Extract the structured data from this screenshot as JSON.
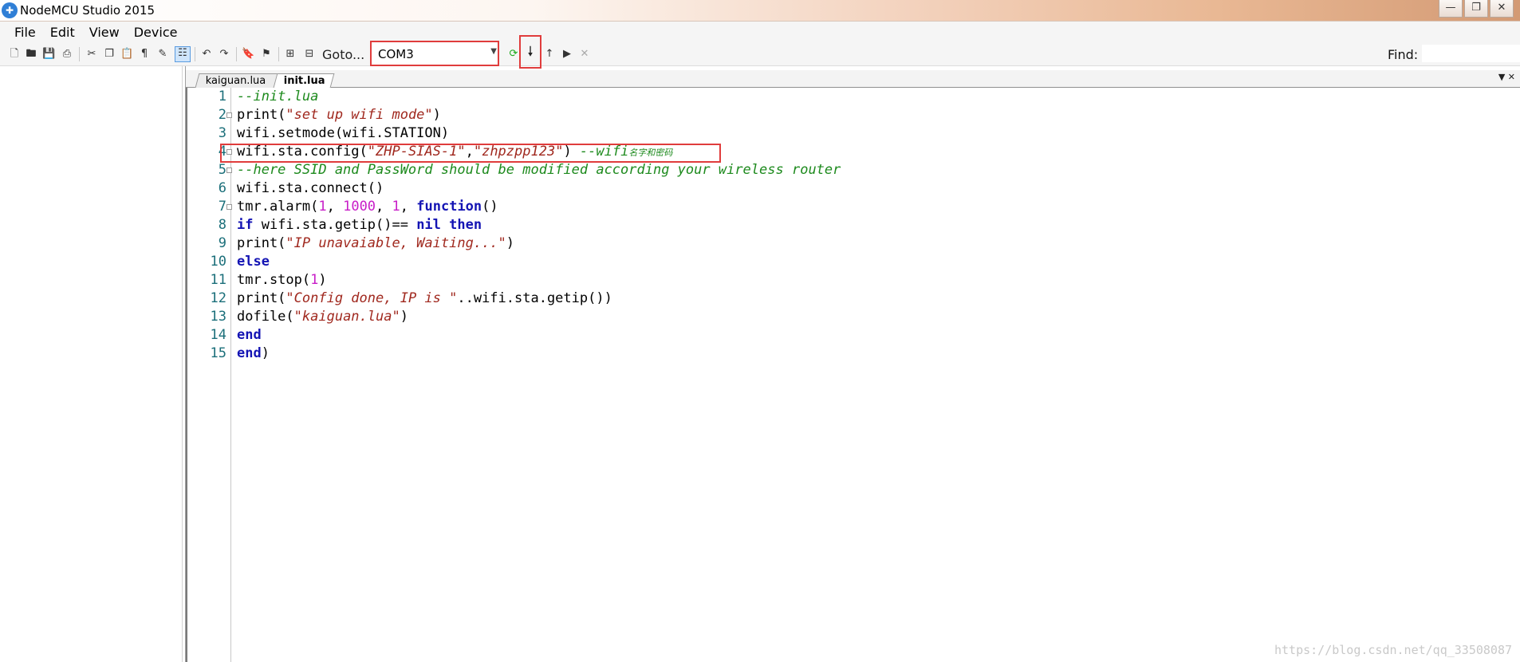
{
  "window": {
    "title": "NodeMCU Studio 2015",
    "app_icon": "nodemcu-icon"
  },
  "window_controls": {
    "minimize": "—",
    "restore": "❐",
    "close": "✕"
  },
  "menu": [
    "File",
    "Edit",
    "View",
    "Device"
  ],
  "toolbar": {
    "goto_label": "Goto...",
    "port": "COM3",
    "find_label": "Find:",
    "find_value": ""
  },
  "tabs": [
    {
      "label": "kaiguan.lua",
      "active": false
    },
    {
      "label": "init.lua",
      "active": true
    }
  ],
  "editor": {
    "line_numbers": [
      "1",
      "2",
      "3",
      "4",
      "5",
      "6",
      "7",
      "8",
      "9",
      "10",
      "11",
      "12",
      "13",
      "14",
      "15"
    ],
    "code": {
      "l1_comment": "--init.lua",
      "l2_fn": "print(",
      "l2_str": "\"set up wifi mode\"",
      "l2_end": ")",
      "l3": "wifi.setmode(wifi.STATION)",
      "l4_fn": "wifi.sta.config(",
      "l4_str1": "\"ZHP-SIAS-1\"",
      "l4_comma": ",",
      "l4_str2": "\"zhpzpp123\"",
      "l4_end": ") ",
      "l4_comment": "--wifi",
      "l4_comment_cn": "名字和密码",
      "l5_comment": "--here SSID and PassWord should be modified according your wireless router",
      "l6": "wifi.sta.connect()",
      "l7_fn": "tmr.alarm(",
      "l7_n1": "1",
      "l7_c1": ", ",
      "l7_n2": "1000",
      "l7_c2": ", ",
      "l7_n3": "1",
      "l7_c3": ", ",
      "l7_kw": "function",
      "l7_end": "()",
      "l8_kw1": "if",
      "l8_mid": " wifi.sta.getip()== ",
      "l8_kw2": "nil",
      "l8_sp": " ",
      "l8_kw3": "then",
      "l9_fn": "print(",
      "l9_str": "\"IP unavaiable, Waiting...\"",
      "l9_end": ")",
      "l10_kw": "else",
      "l11_fn": "tmr.stop(",
      "l11_n": "1",
      "l11_end": ")",
      "l12_fn": "print(",
      "l12_str": "\"Config done, IP is \"",
      "l12_end": "..wifi.sta.getip())",
      "l13_fn": "dofile(",
      "l13_str": "\"kaiguan.lua\"",
      "l13_end": ")",
      "l14_kw": "end",
      "l15_kw": "end",
      "l15_end": ")"
    }
  },
  "watermark": "https://blog.csdn.net/qq_33508087",
  "colors": {
    "highlight_box": "#e03c3c",
    "comment": "#1d8a1d",
    "string": "#a0281e",
    "keyword": "#1414b4",
    "number": "#c81ec8"
  }
}
